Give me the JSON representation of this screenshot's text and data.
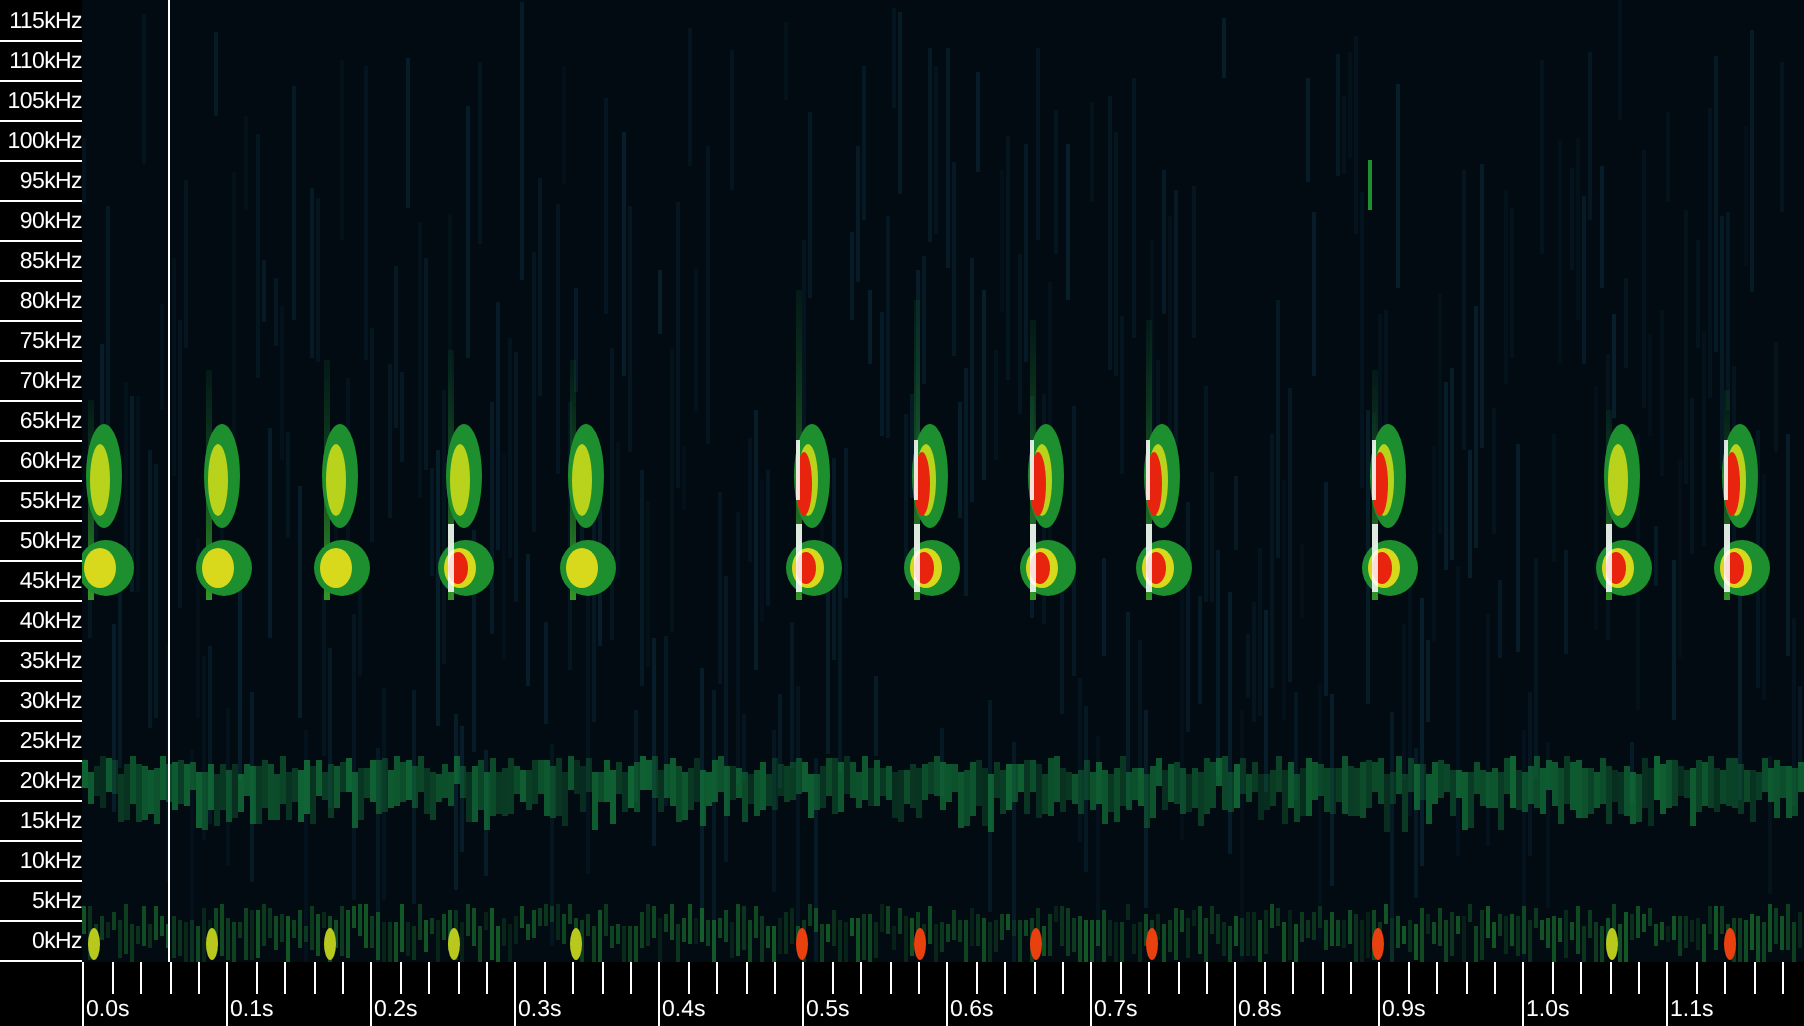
{
  "frequency_axis": {
    "labels": [
      "115kHz",
      "110kHz",
      "105kHz",
      "100kHz",
      "95kHz",
      "90kHz",
      "85kHz",
      "80kHz",
      "75kHz",
      "70kHz",
      "65kHz",
      "60kHz",
      "55kHz",
      "50kHz",
      "45kHz",
      "40kHz",
      "35kHz",
      "30kHz",
      "25kHz",
      "20kHz",
      "15kHz",
      "10kHz",
      "5kHz",
      "0kHz"
    ]
  },
  "time_axis": {
    "labels": [
      "0.0s",
      "0.1s",
      "0.2s",
      "0.3s",
      "0.4s",
      "0.5s",
      "0.6s",
      "0.7s",
      "0.8s",
      "0.9s",
      "1.0s",
      "1.1s"
    ]
  }
}
